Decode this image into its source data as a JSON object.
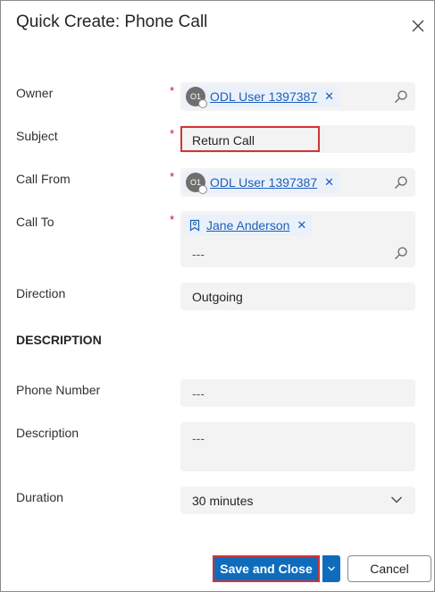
{
  "dialog": {
    "title": "Quick Create: Phone Call",
    "close_icon": "close-icon"
  },
  "form": {
    "owner": {
      "label": "Owner",
      "required_marker": "*",
      "value": "ODL User 1397387",
      "avatar_initials": "O1"
    },
    "subject": {
      "label": "Subject",
      "required_marker": "*",
      "value": "Return Call"
    },
    "call_from": {
      "label": "Call From",
      "required_marker": "*",
      "value": "ODL User 1397387",
      "avatar_initials": "O1"
    },
    "call_to": {
      "label": "Call To",
      "required_marker": "*",
      "value": "Jane Anderson",
      "input_placeholder": "---"
    },
    "direction": {
      "label": "Direction",
      "value": "Outgoing"
    },
    "description_section": {
      "heading": "DESCRIPTION"
    },
    "phone_number": {
      "label": "Phone Number",
      "placeholder": "---"
    },
    "description": {
      "label": "Description",
      "placeholder": "---"
    },
    "duration": {
      "label": "Duration",
      "value": "30 minutes"
    }
  },
  "footer": {
    "save_label": "Save and Close",
    "cancel_label": "Cancel"
  },
  "colors": {
    "accent": "#0f6cbd",
    "required": "#c50f1f",
    "highlight_border": "#d13438",
    "field_bg": "#f3f3f3",
    "link": "#1c5fb8"
  }
}
